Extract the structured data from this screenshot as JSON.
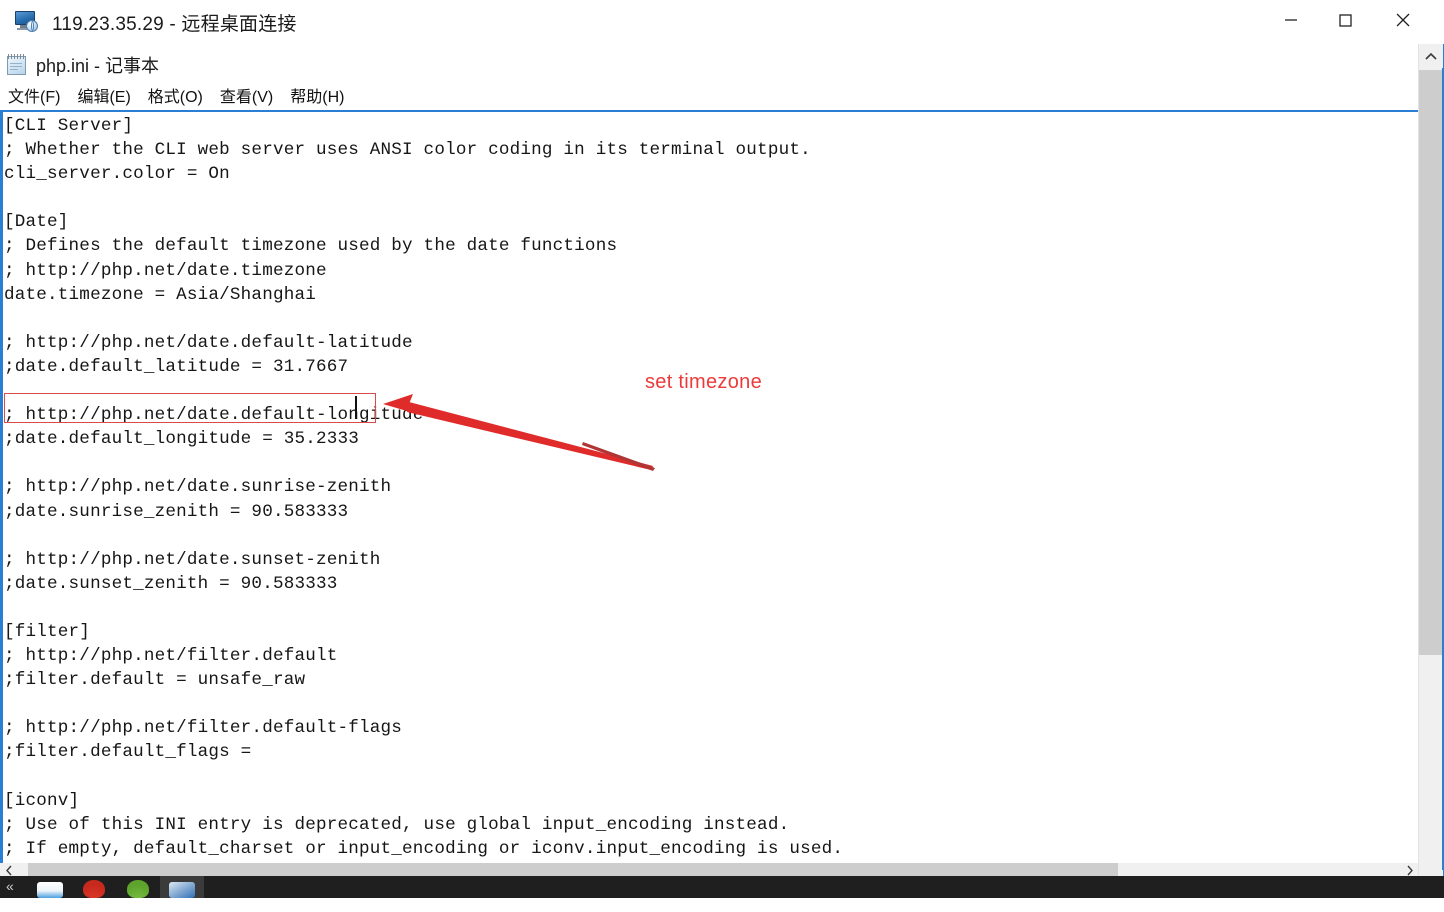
{
  "rdp_window": {
    "title": "119.23.35.29 - 远程桌面连接",
    "icon": "remote-desktop-monitor-icon",
    "controls": {
      "minimize": "—",
      "maximize": "□",
      "close": "✕"
    }
  },
  "notepad": {
    "title": "php.ini - 记事本",
    "icon": "notepad-icon",
    "menu": [
      {
        "label": "文件(F)",
        "name": "menu-file"
      },
      {
        "label": "编辑(E)",
        "name": "menu-edit"
      },
      {
        "label": "格式(O)",
        "name": "menu-format"
      },
      {
        "label": "查看(V)",
        "name": "menu-view"
      },
      {
        "label": "帮助(H)",
        "name": "menu-help"
      }
    ],
    "content": "[CLI Server]\n; Whether the CLI web server uses ANSI color coding in its terminal output.\ncli_server.color = On\n\n[Date]\n; Defines the default timezone used by the date functions\n; http://php.net/date.timezone\ndate.timezone = Asia/Shanghai\n\n; http://php.net/date.default-latitude\n;date.default_latitude = 31.7667\n\n; http://php.net/date.default-longitude\n;date.default_longitude = 35.2333\n\n; http://php.net/date.sunrise-zenith\n;date.sunrise_zenith = 90.583333\n\n; http://php.net/date.sunset-zenith\n;date.sunset_zenith = 90.583333\n\n[filter]\n; http://php.net/filter.default\n;filter.default = unsafe_raw\n\n; http://php.net/filter.default-flags\n;filter.default_flags =\n\n[iconv]\n; Use of this INI entry is deprecated, use global input_encoding instead.\n; If empty, default_charset or input_encoding or iconv.input_encoding is used.\n; The precedence is: default_charset < intput_encoding < iconv.input_encoding",
    "edited_line": "date.timezone = Asia/Shanghai",
    "scrollbar": {
      "vertical_up": "▲",
      "vertical_down": "▼",
      "horizontal_left": "◄",
      "horizontal_right": "►"
    }
  },
  "annotation": {
    "label": "set timezone",
    "color": "#ec3a3a",
    "arrow": "red-arrow-pointing-left",
    "highlight_color": "#d94a4a"
  },
  "taskbar": {
    "overflow": "«",
    "items": [
      {
        "name": "taskbar-item-explorer",
        "glyph": "file-explorer-icon",
        "active": false
      },
      {
        "name": "taskbar-item-red-app",
        "glyph": "red-app-icon",
        "active": false
      },
      {
        "name": "taskbar-item-green-app",
        "glyph": "green-app-icon",
        "active": false
      },
      {
        "name": "taskbar-item-notepad",
        "glyph": "notepad-icon",
        "active": true
      }
    ]
  }
}
